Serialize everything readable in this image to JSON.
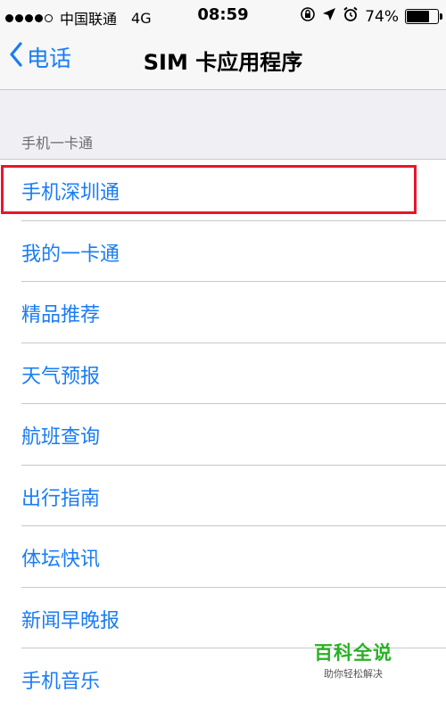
{
  "status_bar": {
    "carrier": "中国联通",
    "network": "4G",
    "time": "08:59",
    "battery_percent": "74%",
    "battery_level": 0.74,
    "icons": [
      "lock-rotation-icon",
      "location-arrow-icon",
      "alarm-icon"
    ]
  },
  "nav": {
    "back_label": "电话",
    "title": "SIM 卡应用程序"
  },
  "section": {
    "header": "手机一卡通"
  },
  "list": {
    "items": [
      {
        "label": "手机深圳通"
      },
      {
        "label": "我的一卡通"
      },
      {
        "label": "精品推荐"
      },
      {
        "label": "天气预报"
      },
      {
        "label": "航班查询"
      },
      {
        "label": "出行指南"
      },
      {
        "label": "体坛快讯"
      },
      {
        "label": "新闻早晚报"
      },
      {
        "label": "手机音乐"
      }
    ]
  },
  "watermark": {
    "title": "百科全说",
    "subtitle": "助你轻松解决"
  },
  "colors": {
    "accent": "#1a7cf4",
    "highlight": "#e8162b",
    "watermark": "#27b324",
    "background": "#efeff4"
  }
}
